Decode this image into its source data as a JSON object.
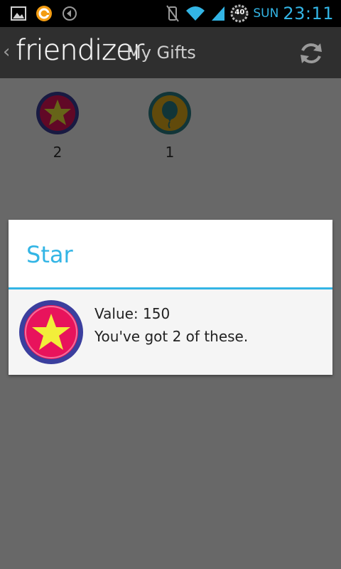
{
  "status_bar": {
    "day": "SUN",
    "time": "23:11",
    "battery_level": "40",
    "icons": [
      "image-notification-icon",
      "app-notification-icon",
      "media-notification-icon",
      "vibrate-icon",
      "wifi-icon",
      "signal-icon",
      "battery-icon"
    ]
  },
  "action_bar": {
    "logo": "friendizer",
    "title": "My Gifts",
    "refresh_icon": "refresh-icon"
  },
  "gifts": [
    {
      "name": "star-gift",
      "count": "2"
    },
    {
      "name": "balloon-gift",
      "count": "1"
    }
  ],
  "dialog": {
    "title": "Star",
    "value_text": "Value: 150",
    "count_text": "You've got 2 of these."
  },
  "colors": {
    "accent": "#33b5e5",
    "action_bar": "#2f2f2f",
    "star_badge": "#e8135c",
    "star_ring": "#3b3f9e",
    "star": "#f2ee3a",
    "balloon_badge": "#e6b11b",
    "balloon_ring": "#2a7f86"
  }
}
